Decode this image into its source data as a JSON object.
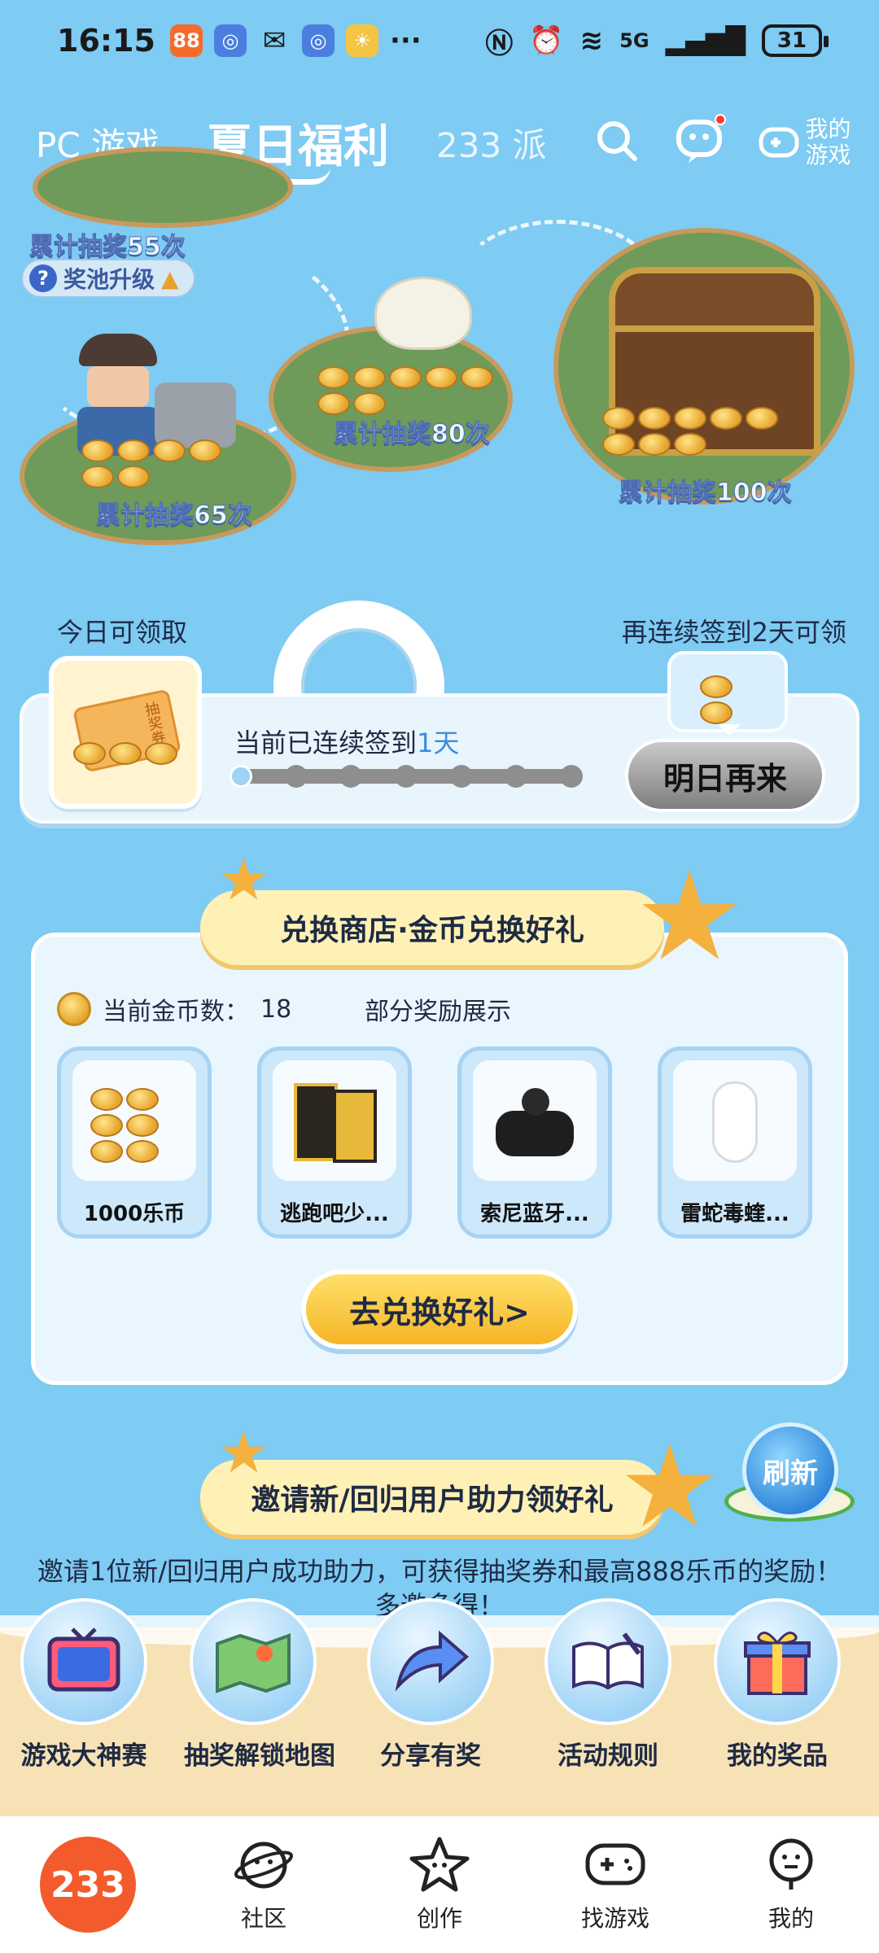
{
  "status_bar": {
    "time": "16:15",
    "network": "5G",
    "battery": "31"
  },
  "top_nav": {
    "tabs": [
      {
        "label": "PC 游戏"
      },
      {
        "label": "夏日福利"
      },
      {
        "label": "233 派"
      }
    ],
    "my_games_label": "我的游戏"
  },
  "map": {
    "pool_upgrade": "奖池升级",
    "milestones": [
      {
        "label": "累计抽奖55次"
      },
      {
        "label": "累计抽奖65次"
      },
      {
        "label": "累计抽奖80次"
      },
      {
        "label": "累计抽奖100次"
      }
    ]
  },
  "checkin": {
    "today_label": "今日可领取",
    "next_label": "再连续签到2天可领",
    "streak_prefix": "当前已连续签到",
    "streak_days": "1天",
    "ticket_label": "抽奖券",
    "progress_days_done": 1,
    "progress_days_total": 7,
    "tomorrow_button": "明日再来"
  },
  "shop": {
    "title": "兑换商店·金币兑换好礼",
    "coin_label": "当前金币数：",
    "coin_value": "18",
    "partial_label": "部分奖励展示",
    "prizes": [
      {
        "name": "1000乐币",
        "icon": "coin-stack-icon"
      },
      {
        "name": "逃跑吧少...",
        "icon": "game-box-icon"
      },
      {
        "name": "索尼蓝牙...",
        "icon": "earbuds-icon"
      },
      {
        "name": "雷蛇毒蝰...",
        "icon": "mouse-icon"
      }
    ],
    "exchange_button": "去兑换好礼>"
  },
  "invite": {
    "title": "邀请新/回归用户助力领好礼",
    "refresh": "刷新",
    "text": "邀请1位新/回归用户成功助力，可获得抽奖券和最高888乐币的奖励！多邀多得！"
  },
  "activities": [
    {
      "label": "游戏大神赛",
      "icon": "tv-icon"
    },
    {
      "label": "抽奖解锁地图",
      "icon": "map-icon"
    },
    {
      "label": "分享有奖",
      "icon": "share-icon"
    },
    {
      "label": "活动规则",
      "icon": "book-icon"
    },
    {
      "label": "我的奖品",
      "icon": "gift-icon"
    }
  ],
  "bottom_nav": {
    "logo": "233",
    "items": [
      {
        "label": "社区",
        "icon": "planet-face-icon"
      },
      {
        "label": "创作",
        "icon": "star-face-icon"
      },
      {
        "label": "找游戏",
        "icon": "gamepad-icon"
      },
      {
        "label": "我的",
        "icon": "person-face-icon"
      }
    ]
  },
  "colors": {
    "sky": "#7ecbf3",
    "accent_blue": "#3b8de0",
    "ribbon": "#fff1b5",
    "brand_orange": "#f35b2c"
  }
}
